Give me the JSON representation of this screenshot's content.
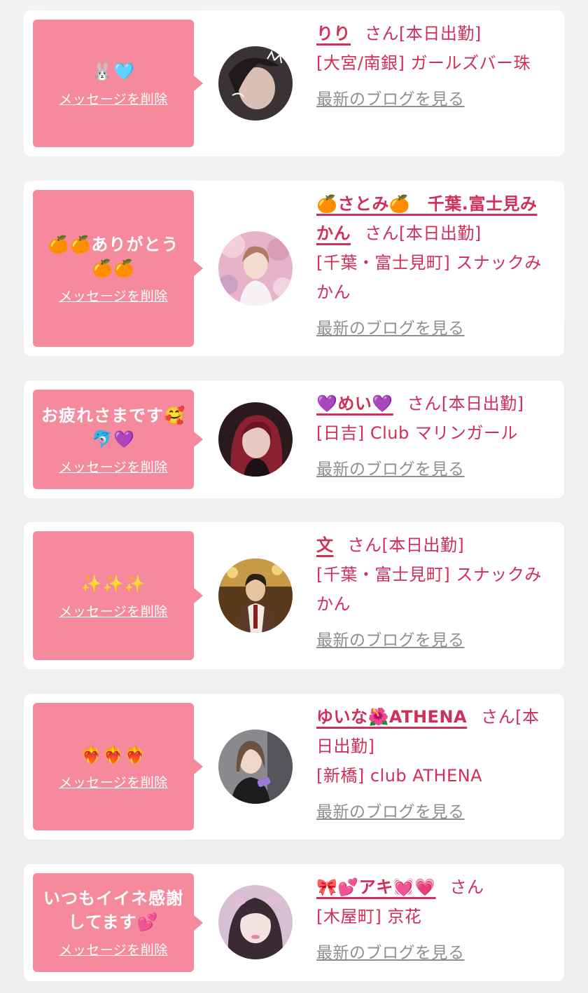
{
  "delete_label": "メッセージを削除",
  "blog_label": "最新のブログを見る",
  "colors": {
    "accent": "#d22e5a",
    "bubble": "#f48a9c",
    "blog_link": "#8f8f8f",
    "background": "#eeeeee",
    "card": "#ffffff"
  },
  "cards": [
    {
      "message": "🐰🩵",
      "name": "りり",
      "suffix": "さん[本日出勤]",
      "shop": "[大宮/南銀] ガールズバー珠",
      "avatar_icon": "avatar-girl-selfie"
    },
    {
      "message": "🍊🍊ありがとう🍊🍊",
      "name": "🍊さとみ🍊　千葉.富士見みかん",
      "suffix": "さん[本日出勤]",
      "shop": "[千葉・富士見町] スナックみかん",
      "avatar_icon": "avatar-cherry-blossom"
    },
    {
      "message": "お疲れさまです🥰🐬💜",
      "name": "💜めい💜",
      "suffix": "さん[本日出勤]",
      "shop": "[日吉] Club マリンガール",
      "avatar_icon": "avatar-red-hair"
    },
    {
      "message": "✨✨✨",
      "name": "文",
      "suffix": "さん[本日出勤]",
      "shop": "[千葉・富士見町] スナックみかん",
      "avatar_icon": "avatar-anime-boy"
    },
    {
      "message": "❤️‍🔥❤️‍🔥❤️‍🔥",
      "name": "ゆいな🌺ATHENA",
      "suffix": "さん[本日出勤]",
      "shop": "[新橋] club ATHENA",
      "avatar_icon": "avatar-girl-drink"
    },
    {
      "message": "いつもイイネ感謝してます💕",
      "name": "🎀💕アキ💓💗",
      "suffix": "さん",
      "shop": "[木屋町] 京花",
      "avatar_icon": "avatar-girl-pink-filter"
    }
  ]
}
